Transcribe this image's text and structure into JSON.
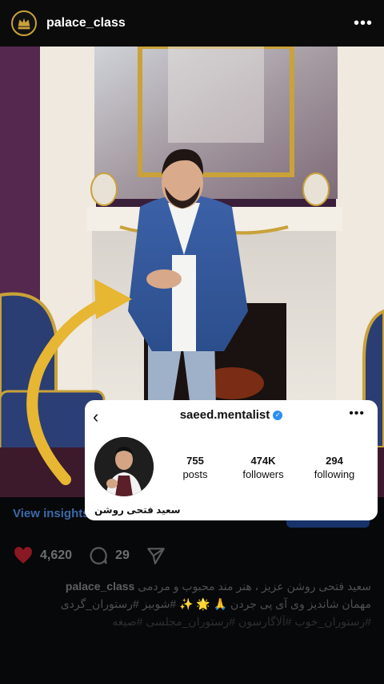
{
  "header": {
    "username": "palace_class",
    "more_icon": "more-icon",
    "avatar_icon": "crown-logo-icon"
  },
  "post": {
    "insights_label": "View insights",
    "likes": "4,620",
    "comments": "29",
    "caption_user": "palace_class",
    "caption_line1": "سعید فتحی روشن  عزیز ، هنر مند محبوب و مردمی",
    "caption_line2": "مهمان شاندیز وی آی پی جردن 🙏 🌟 ✨ #شوبیز #رستوران_گردی",
    "caption_line3": "#رستوران_خوب #آلاگارسون #رستوران_مجلسی #صیغه"
  },
  "profile_card": {
    "handle": "saeed.mentalist",
    "posts_count": "755",
    "posts_label": "posts",
    "followers_count": "474K",
    "followers_label": "followers",
    "following_count": "294",
    "following_label": "following",
    "display_name": "سعید فتحی روشن"
  },
  "colors": {
    "accent_blue": "#3b6aa8",
    "verified": "#2b8ff0",
    "heart": "#ed4956"
  }
}
